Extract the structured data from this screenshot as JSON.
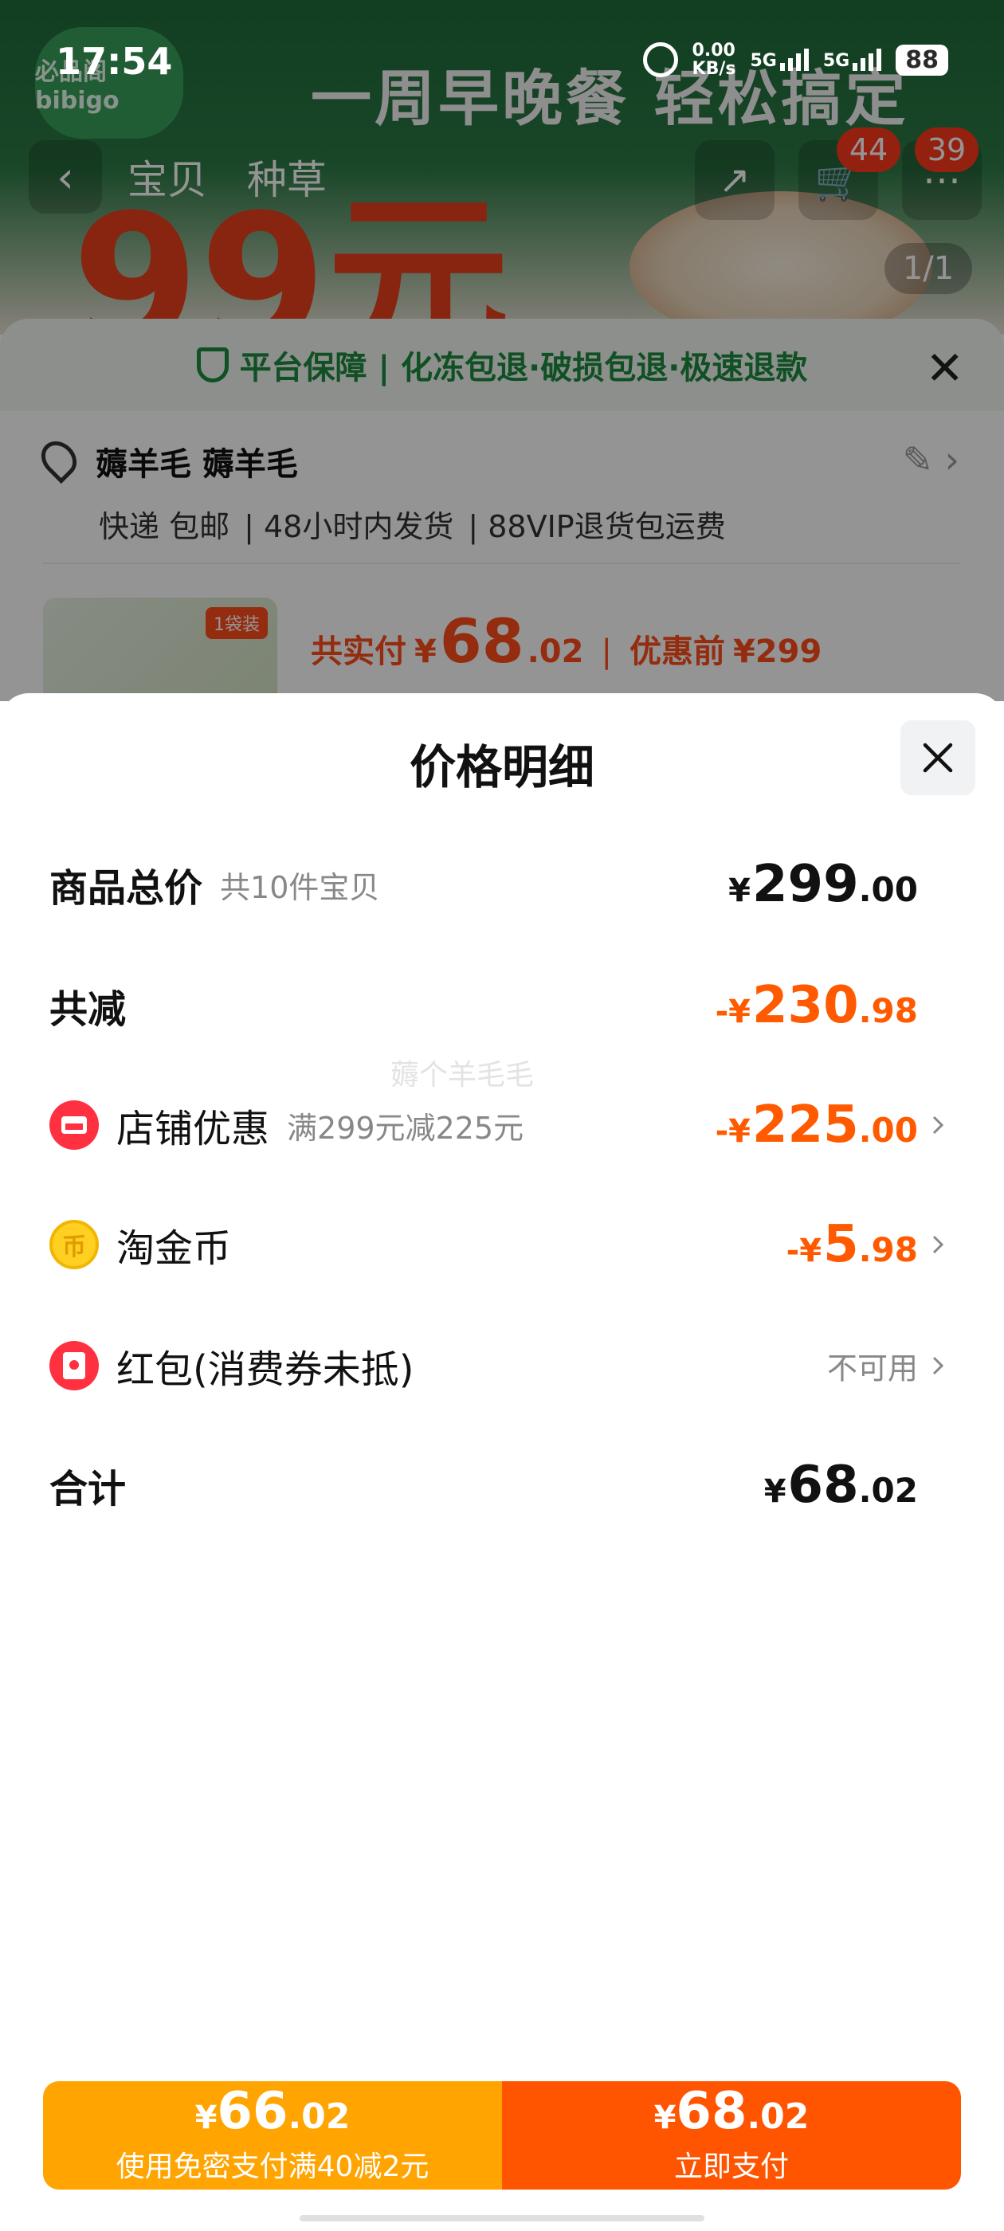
{
  "status_bar": {
    "time": "17:54",
    "speed_value": "0.00",
    "speed_unit": "KB/s",
    "network_1": "5G",
    "network_2": "5G",
    "battery": "88"
  },
  "background": {
    "brand": "必品阁 bibigo",
    "slogan": "一周早晚餐 轻松搞定",
    "banner_price": "99元",
    "nav_tabs": [
      "宝贝",
      "种草"
    ],
    "cart_badge": "44",
    "more_badge": "39",
    "image_pager": "1/1",
    "guarantee_text": "平台保障 | 化冻包退·破损包退·极速退款",
    "address_name": "薅羊毛 薅羊毛",
    "shipping_tags": [
      "快递 包邮",
      "48小时内发货",
      "88VIP退货包运费"
    ],
    "item_tag": "1袋装",
    "item_pay_label": "共实付",
    "item_pay_currency": "¥",
    "item_pay_int": "68",
    "item_pay_dec": ".02",
    "item_before_label": "优惠前",
    "item_before_price": "¥299",
    "colors": {
      "accent": "#ff4d1a",
      "guarantee": "#1c8a3e"
    }
  },
  "price_detail": {
    "title": "价格明细",
    "watermark": "薅个羊毛毛",
    "rows": {
      "total": {
        "label": "商品总价",
        "sub": "共10件宝贝",
        "currency": "¥",
        "int": "299",
        "dec": ".00"
      },
      "reduce": {
        "label": "共减",
        "currency": "-¥",
        "int": "230",
        "dec": ".98"
      },
      "shop": {
        "label": "店铺优惠",
        "sub": "满299元减225元",
        "currency": "-¥",
        "int": "225",
        "dec": ".00",
        "icon": "shop-icon"
      },
      "coin": {
        "label": "淘金币",
        "currency": "-¥",
        "int": "5",
        "dec": ".98",
        "icon": "coin-icon",
        "icon_glyph": "币"
      },
      "redpacket": {
        "label": "红包(消费券未抵)",
        "status": "不可用",
        "icon": "red-packet-icon"
      },
      "sum": {
        "label": "合计",
        "currency": "¥",
        "int": "68",
        "dec": ".02"
      }
    },
    "colors": {
      "discount": "#ff5a00",
      "text": "#111111"
    }
  },
  "pay_bar": {
    "left": {
      "currency": "¥",
      "int": "66",
      "dec": ".02",
      "desc": "使用免密支付满40减2元",
      "color": "#ffa400"
    },
    "right": {
      "currency": "¥",
      "int": "68",
      "dec": ".02",
      "desc": "立即支付",
      "color": "#ff5500"
    }
  }
}
